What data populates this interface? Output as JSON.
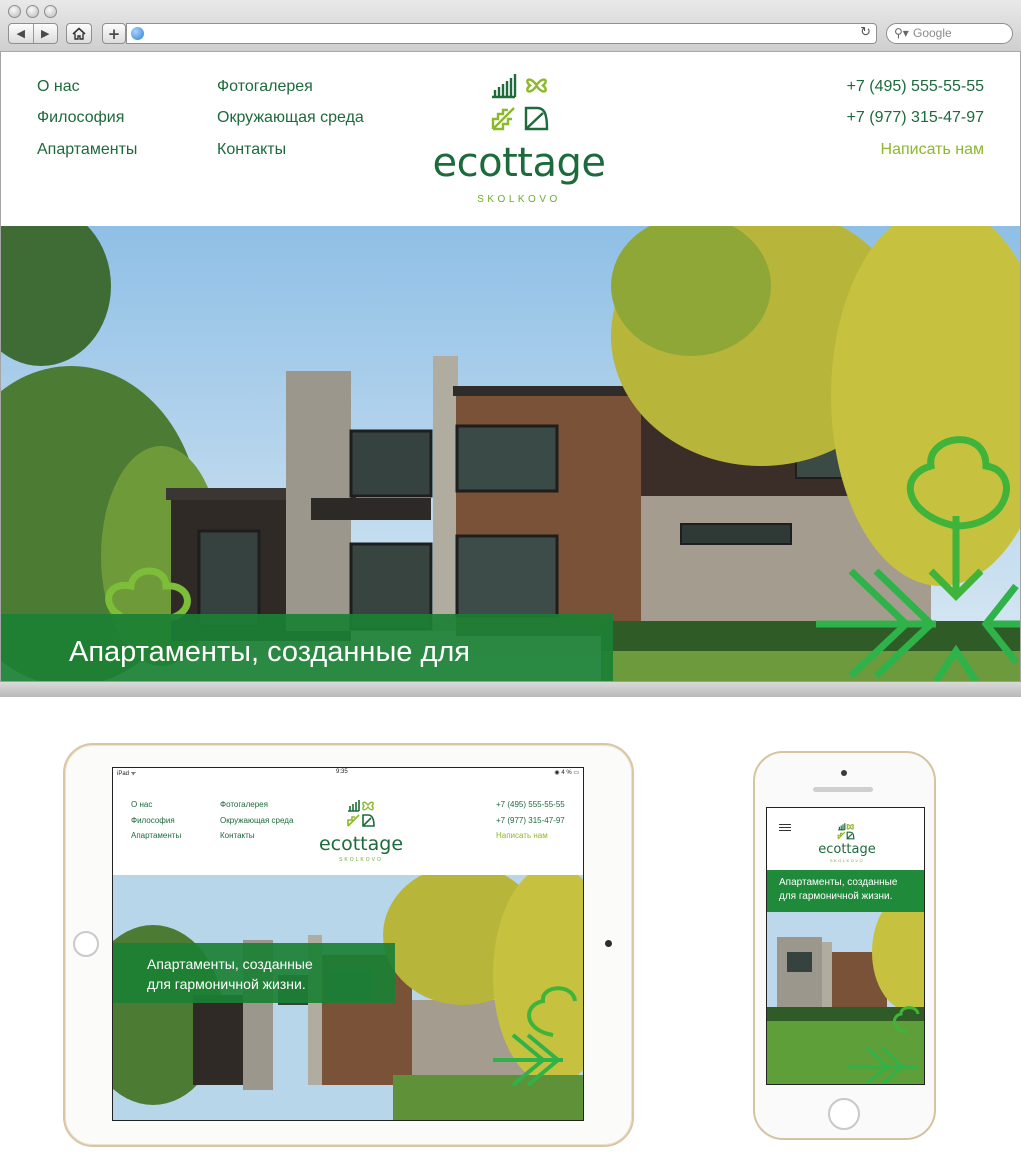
{
  "browser": {
    "nav_back": "◀",
    "nav_forward": "▶",
    "home_icon": "home-icon",
    "add_label": "+",
    "search_placeholder": "Google",
    "reload_glyph": "↻"
  },
  "site": {
    "nav_col1": [
      "О нас",
      "Философия",
      "Апартаменты"
    ],
    "nav_col2": [
      "Фотогалерея",
      "Окружающая среда",
      "Контакты"
    ],
    "phones": [
      "+7 (495) 555-55-55",
      "+7 (977) 315-47-97"
    ],
    "write_us": "Написать нам",
    "logo_word": "ecottage",
    "logo_sub": "SKOLKOVO",
    "hero_text": "Апартаменты, созданные для"
  },
  "tablet": {
    "status_left": "iPad ᯤ",
    "status_time": "9:35",
    "status_right": "◉ 4 % ▭",
    "nav_col1": [
      "О нас",
      "Философия",
      "Апартаменты"
    ],
    "nav_col2": [
      "Фотогалерея",
      "Окружающая среда",
      "Контакты"
    ],
    "phones": [
      "+7 (495) 555-55-55",
      "+7 (977) 315-47-97"
    ],
    "write_us": "Написать нам",
    "logo_word": "ecottage",
    "logo_sub": "SKOLKOVO",
    "hero_line1": "Апартаменты, созданные",
    "hero_line2": "для гармоничной жизни."
  },
  "phone": {
    "logo_word": "ecottage",
    "logo_sub": "SKOLKOVO",
    "hero_line1": "Апартаменты, созданные",
    "hero_line2": "для гармоничной жизни."
  },
  "colors": {
    "brand_dark_green": "#1d6a3c",
    "brand_light_green": "#8cb82b",
    "band_green": "#1b8034"
  }
}
